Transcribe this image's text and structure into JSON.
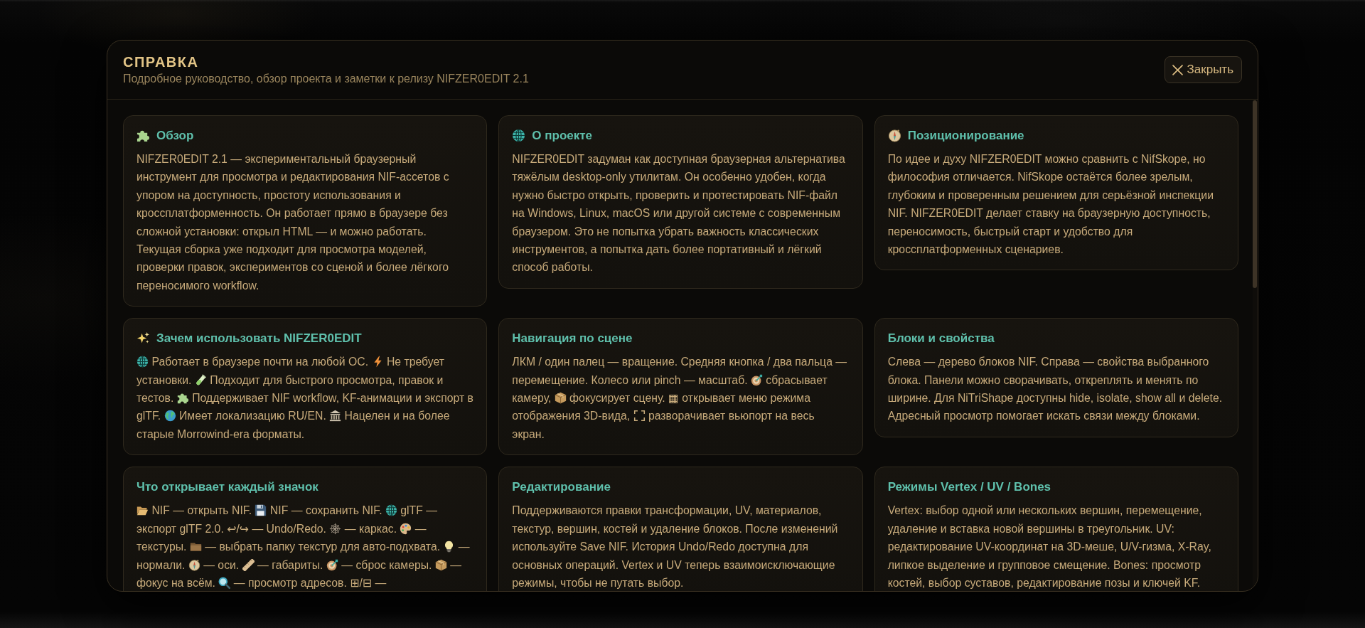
{
  "dialog": {
    "title": "СПРАВКА",
    "subtitle": "Подробное руководство, обзор проекта и заметки к релизу NIFZER0EDIT 2.1",
    "close_button": {
      "label": "Закрыть"
    }
  },
  "sections": [
    {
      "title": [
        {
          "kind": "puzzle"
        },
        {
          "kind": "text",
          "text": "Обзор"
        }
      ],
      "body": [
        {
          "kind": "text",
          "text": "NIFZER0EDIT 2.1 — экспериментальный браузерный инструмент для просмотра и редактирования NIF-ассетов с упором на доступность, простоту использования и кроссплатформенность. Он работает прямо в браузере без сложной установки: открыл HTML — и можно работать. Текущая сборка уже подходит для просмотра моделей, проверки правок, экспериментов со сценой и более лёгкого переносимого workflow."
        }
      ]
    },
    {
      "title": [
        {
          "kind": "globe"
        },
        {
          "kind": "text",
          "text": "О проекте"
        }
      ],
      "body": [
        {
          "kind": "text",
          "text": "NIFZER0EDIT задуман как доступная браузерная альтернатива тяжёлым desktop-only утилитам. Он особенно удобен, когда нужно быстро открыть, проверить и протестировать NIF-файл на Windows, Linux, macOS или другой системе с современным браузером. Это не попытка убрать важность классических инструментов, а попытка дать более портативный и лёгкий способ работы."
        }
      ]
    },
    {
      "title": [
        {
          "kind": "compass"
        },
        {
          "kind": "text",
          "text": "Позиционирование"
        }
      ],
      "body": [
        {
          "kind": "text",
          "text": "По идее и духу NIFZER0EDIT можно сравнить с NifSkope, но философия отличается. NifSkope остаётся более зрелым, глубоким и проверенным решением для серьёзной инспекции NIF. NIFZER0EDIT делает ставку на браузерную доступность, переносимость, быстрый старт и удобство для кроссплатформенных сценариев."
        }
      ]
    },
    {
      "title": [
        {
          "kind": "sparkles"
        },
        {
          "kind": "text",
          "text": "Зачем использовать NIFZER0EDIT"
        }
      ],
      "body": [
        {
          "kind": "globe"
        },
        {
          "kind": "text",
          "text": " Работает в браузере почти на любой ОС. "
        },
        {
          "kind": "bolt"
        },
        {
          "kind": "text",
          "text": " Не требует установки. "
        },
        {
          "kind": "tube"
        },
        {
          "kind": "text",
          "text": " Подходит для быстрого просмотра, правок и тестов. "
        },
        {
          "kind": "puzzle"
        },
        {
          "kind": "text",
          "text": " Поддерживает NIF workflow, KF-анимации и экспорт в glTF. "
        },
        {
          "kind": "earth"
        },
        {
          "kind": "text",
          "text": " Имеет локализацию RU/EN. "
        },
        {
          "kind": "building"
        },
        {
          "kind": "text",
          "text": " Нацелен и на более старые Morrowind-era форматы."
        }
      ]
    },
    {
      "title": [
        {
          "kind": "text",
          "text": "Навигация по сцене"
        }
      ],
      "body": [
        {
          "kind": "text",
          "text": "ЛКМ / один палец — вращение. Средняя кнопка / два пальца — перемещение. Колесо или pinch — масштаб. "
        },
        {
          "kind": "target"
        },
        {
          "kind": "text",
          "text": " сбрасывает камеру, "
        },
        {
          "kind": "package"
        },
        {
          "kind": "text",
          "text": " фокусирует сцену. ▦ открывает меню режима отображения 3D-вида, "
        },
        {
          "kind": "fullscreen"
        },
        {
          "kind": "text",
          "text": " разворачивает вьюпорт на весь экран."
        }
      ]
    },
    {
      "title": [
        {
          "kind": "text",
          "text": "Блоки и свойства"
        }
      ],
      "body": [
        {
          "kind": "text",
          "text": "Слева — дерево блоков NIF. Справа — свойства выбранного блока. Панели можно сворачивать, откреплять и менять по ширине. Для NiTriShape доступны hide, isolate, show all и delete. Адресный просмотр помогает искать связи между блоками."
        }
      ]
    },
    {
      "title": [
        {
          "kind": "text",
          "text": "Что открывает каждый значок"
        }
      ],
      "body": [
        {
          "kind": "openfolder"
        },
        {
          "kind": "text",
          "text": " NIF — открыть NIF. "
        },
        {
          "kind": "floppy"
        },
        {
          "kind": "text",
          "text": " NIF — сохранить NIF. "
        },
        {
          "kind": "globe"
        },
        {
          "kind": "text",
          "text": " glTF — экспорт glTF 2.0. ↩/↪ — Undo/Redo. "
        },
        {
          "kind": "web"
        },
        {
          "kind": "text",
          "text": " — каркас. "
        },
        {
          "kind": "palette"
        },
        {
          "kind": "text",
          "text": " — текстуры. "
        },
        {
          "kind": "folder"
        },
        {
          "kind": "text",
          "text": " — выбрать папку текстур для авто-подхвата. "
        },
        {
          "kind": "bulb"
        },
        {
          "kind": "text",
          "text": " — нормали. "
        },
        {
          "kind": "compass"
        },
        {
          "kind": "text",
          "text": " — оси. "
        },
        {
          "kind": "ruler"
        },
        {
          "kind": "text",
          "text": " — габариты. "
        },
        {
          "kind": "target"
        },
        {
          "kind": "text",
          "text": " — сброс камеры. "
        },
        {
          "kind": "package"
        },
        {
          "kind": "text",
          "text": " — фокус на всём. "
        },
        {
          "kind": "magnifier"
        },
        {
          "kind": "text",
          "text": " — просмотр адресов. ⊞/⊟ —"
        }
      ]
    },
    {
      "title": [
        {
          "kind": "text",
          "text": "Редактирование"
        }
      ],
      "body": [
        {
          "kind": "text",
          "text": "Поддерживаются правки трансформации, UV, материалов, текстур, вершин, костей и удаление блоков. После изменений используйте Save NIF. История Undo/Redo доступна для основных операций. Vertex и UV теперь взаимоисключающие режимы, чтобы не путать выбор."
        }
      ]
    },
    {
      "title": [
        {
          "kind": "text",
          "text": "Режимы Vertex / UV / Bones"
        }
      ],
      "body": [
        {
          "kind": "text",
          "text": "Vertex: выбор одной или нескольких вершин, перемещение, удаление и вставка новой вершины в треугольник. UV: редактирование UV-координат на 3D-меше, U/V-гизма, X-Ray, липкое выделение и групповое смещение. Bones: просмотр костей, выбор суставов, редактирование позы и ключей KF."
        }
      ]
    }
  ]
}
